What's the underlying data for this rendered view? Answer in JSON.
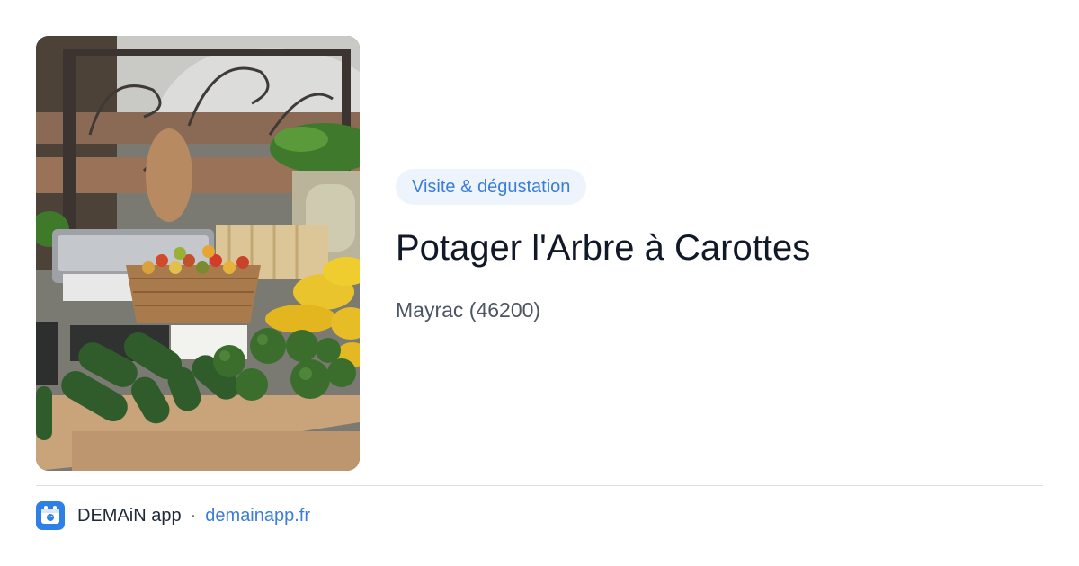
{
  "card": {
    "tag": "Visite & dégustation",
    "title": "Potager l'Arbre à Carottes",
    "location": "Mayrac (46200)"
  },
  "footer": {
    "app_name": "DEMAiN app",
    "separator": "·",
    "link": "demainapp.fr",
    "logo_icon": "demain-logo-icon"
  },
  "colors": {
    "accent": "#3b7dd8",
    "tag_bg": "#eef4fc",
    "logo_bg": "#2f80e6",
    "divider": "#d9e0e6"
  }
}
